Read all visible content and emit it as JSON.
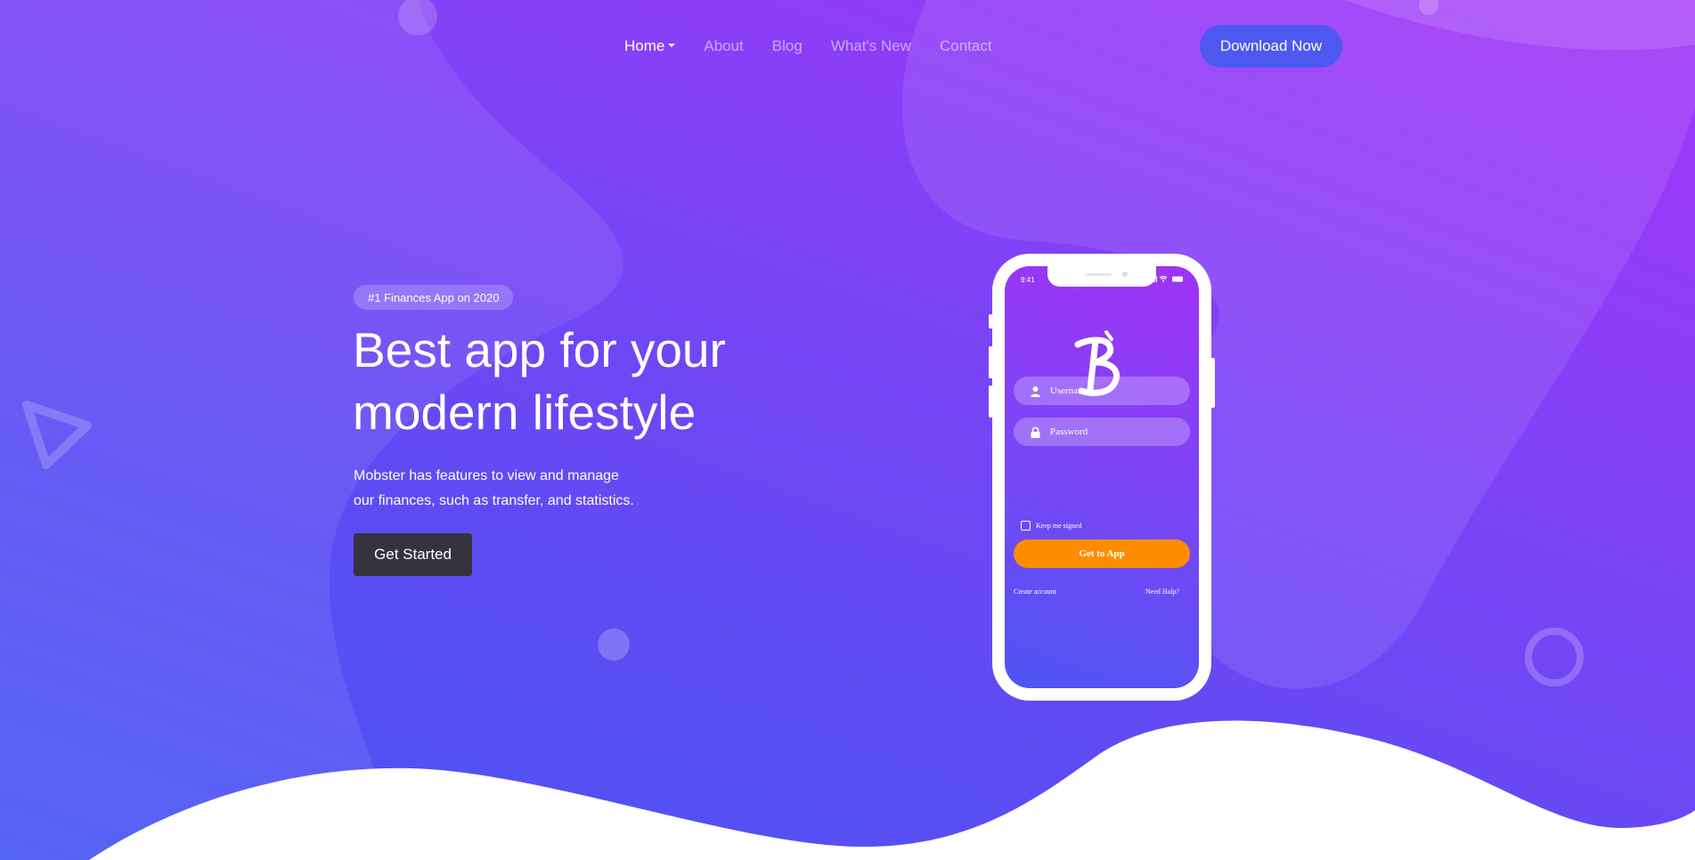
{
  "nav": {
    "items": [
      {
        "label": "Home",
        "active": true,
        "has_dropdown": true
      },
      {
        "label": "About",
        "active": false
      },
      {
        "label": "Blog",
        "active": false
      },
      {
        "label": "What's New",
        "active": false
      },
      {
        "label": "Contact",
        "active": false
      }
    ],
    "download_label": "Download Now"
  },
  "hero": {
    "badge": "#1 Finances App on 2020",
    "headline_line1": "Best app for your",
    "headline_line2": "modern lifestyle",
    "subtext_line1": "Mobster has features to view and manage",
    "subtext_line2": "our finances, such as transfer, and statistics.",
    "cta_label": "Get Started"
  },
  "phone": {
    "status_time": "9:41",
    "logo_icon": "brand-b-logo",
    "username_placeholder": "Username",
    "password_placeholder": "Password",
    "keep_signed": "Keep me signed",
    "submit_label": "Get to App",
    "create_account": "Create account",
    "need_help": "Need Halp?"
  },
  "colors": {
    "gradient_top": "#a336f7",
    "gradient_bottom": "#4657f4",
    "download_button": "#4d58f1",
    "cta_button": "#35333f",
    "phone_submit": "#ff8d00"
  }
}
